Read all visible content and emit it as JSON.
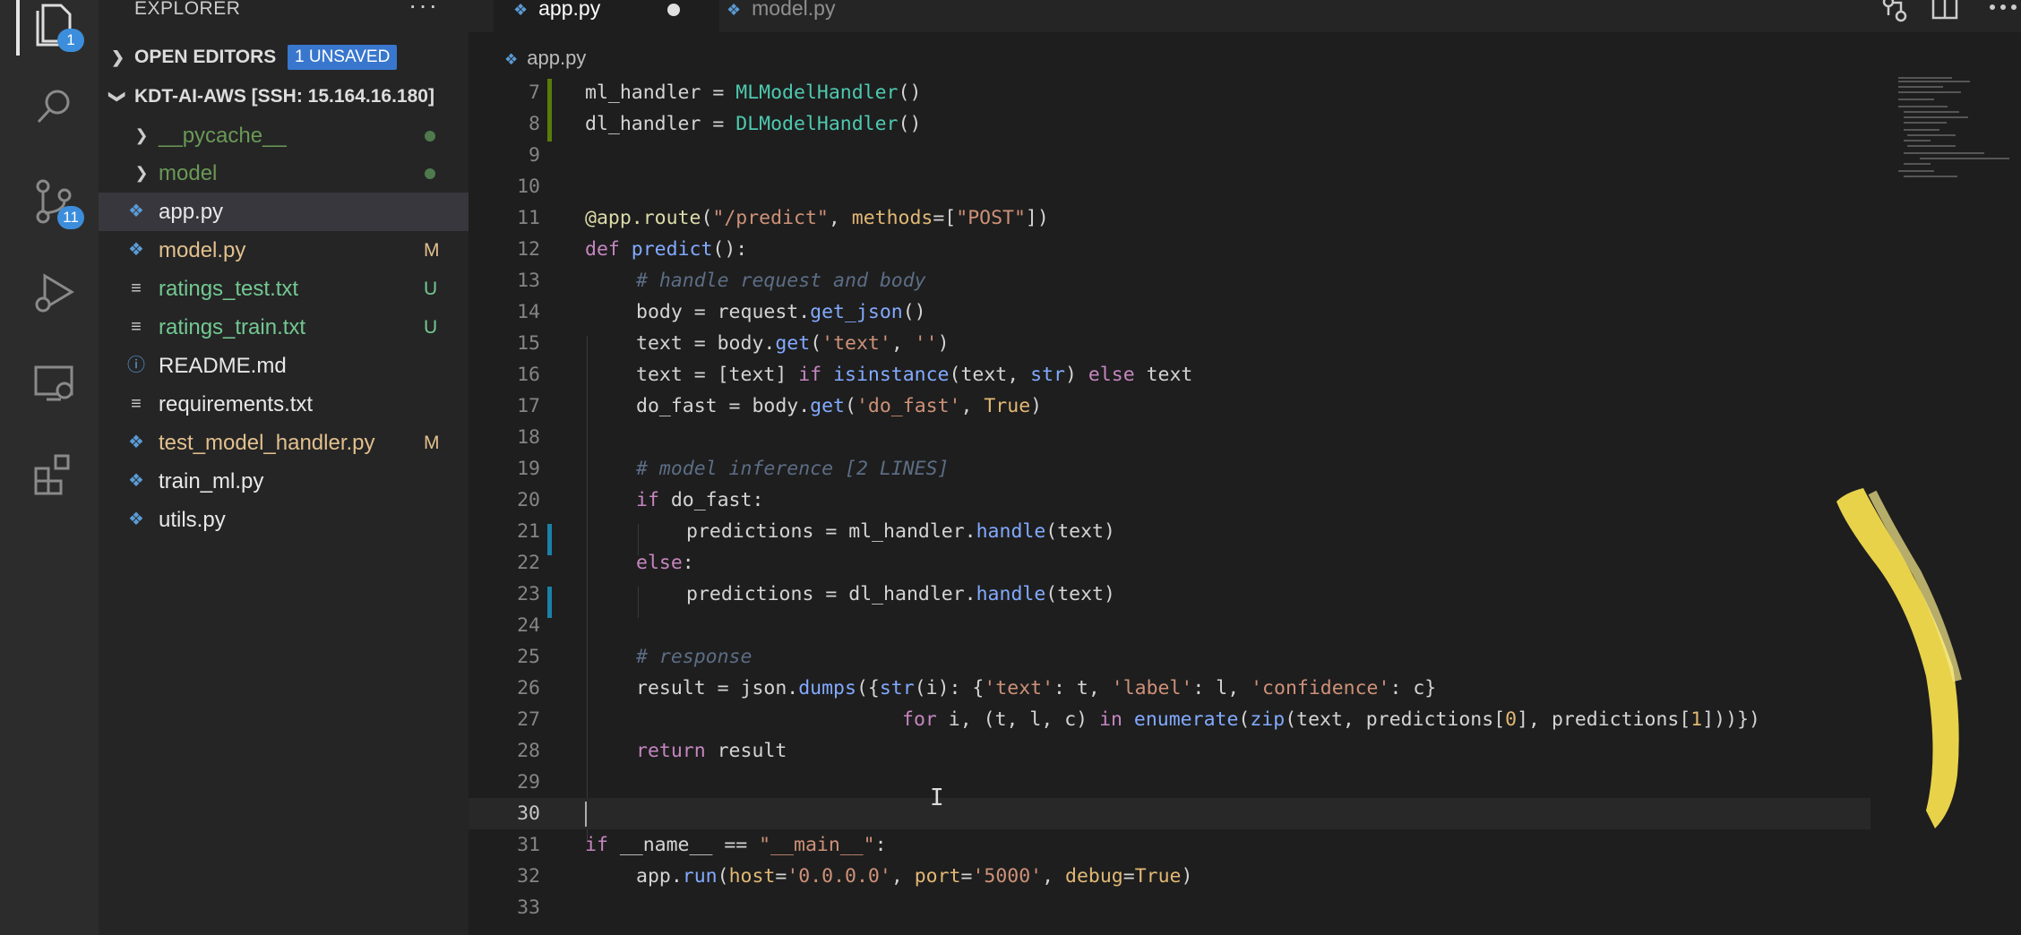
{
  "activity_bar": {
    "explorer_badge": "1",
    "source_control_badge": "11"
  },
  "sidebar": {
    "title": "EXPLORER",
    "more_label": "···",
    "open_editors": {
      "label": "OPEN EDITORS",
      "badge": "1 UNSAVED"
    },
    "workspace": {
      "label": "KDT-AI-AWS [SSH: 15.164.16.180]"
    },
    "files": [
      {
        "name": "__pycache__",
        "status": ""
      },
      {
        "name": "model",
        "status": ""
      },
      {
        "name": "app.py",
        "status": ""
      },
      {
        "name": "model.py",
        "status": "M"
      },
      {
        "name": "ratings_test.txt",
        "status": "U"
      },
      {
        "name": "ratings_train.txt",
        "status": "U"
      },
      {
        "name": "README.md",
        "status": ""
      },
      {
        "name": "requirements.txt",
        "status": ""
      },
      {
        "name": "test_model_handler.py",
        "status": "M"
      },
      {
        "name": "train_ml.py",
        "status": ""
      },
      {
        "name": "utils.py",
        "status": ""
      }
    ]
  },
  "tabs": [
    {
      "label": "app.py"
    },
    {
      "label": "model.py"
    }
  ],
  "breadcrumb": {
    "file": "app.py"
  },
  "editor": {
    "line_numbers": [
      "7",
      "8",
      "9",
      "10",
      "11",
      "12",
      "13",
      "14",
      "15",
      "16",
      "17",
      "18",
      "19",
      "20",
      "21",
      "22",
      "23",
      "24",
      "25",
      "26",
      "27",
      "28",
      "29",
      "30",
      "31",
      "32",
      "33"
    ],
    "lines": {
      "l7": {
        "a": "ml_handler = ",
        "b": "MLModelHandler",
        "c": "()"
      },
      "l8": {
        "a": "dl_handler = ",
        "b": "DLModelHandler",
        "c": "()"
      },
      "l11": {
        "a": "@app.route",
        "b": "(",
        "c": "\"/predict\"",
        "d": ", ",
        "e": "methods",
        "f": "=[",
        "g": "\"POST\"",
        "h": "])"
      },
      "l12": {
        "a": "def",
        "b": " ",
        "c": "predict",
        "d": "():"
      },
      "l13": {
        "a": "# handle request and body"
      },
      "l14": {
        "a": "body = request.",
        "b": "get_json",
        "c": "()"
      },
      "l15": {
        "a": "text = body.",
        "b": "get",
        "c": "(",
        "d": "'text'",
        "e": ", ",
        "f": "''",
        "g": ")"
      },
      "l16": {
        "a": "text = [text] ",
        "b": "if",
        "c": " ",
        "d": "isinstance",
        "e": "(text, ",
        "f": "str",
        "g": ") ",
        "h": "else",
        "i": " text"
      },
      "l17": {
        "a": "do_fast = body.",
        "b": "get",
        "c": "(",
        "d": "'do_fast'",
        "e": ", ",
        "f": "True",
        "g": ")"
      },
      "l19": {
        "a": "# model inference [2 LINES]"
      },
      "l20": {
        "a": "if",
        "b": " do_fast:"
      },
      "l21": {
        "a": "predictions = ml_handler.",
        "b": "handle",
        "c": "(text)"
      },
      "l22": {
        "a": "else",
        "b": ":"
      },
      "l23": {
        "a": "predictions = dl_handler.",
        "b": "handle",
        "c": "(text)"
      },
      "l25": {
        "a": "# response"
      },
      "l26": {
        "a": "result = json.",
        "b": "dumps",
        "c": "({",
        "d": "str",
        "e": "(i): {",
        "f": "'text'",
        "g": ": t, ",
        "h": "'label'",
        "i": ": l, ",
        "j": "'confidence'",
        "k": ": c}"
      },
      "l27": {
        "a": "for",
        "b": " i, (t, l, c) ",
        "c": "in",
        "d": " ",
        "e": "enumerate",
        "f": "(",
        "g": "zip",
        "h": "(text, predictions[",
        "i": "0",
        "j": "], predictions[",
        "k": "1",
        "l": "]))})"
      },
      "l28": {
        "a": "return",
        "b": " result"
      },
      "l31": {
        "a": "if",
        "b": " __name__ == ",
        "c": "\"__main__\"",
        "d": ":"
      },
      "l32": {
        "a": "app.",
        "b": "run",
        "c": "(",
        "d": "host",
        "e": "=",
        "f": "'0.0.0.0'",
        "g": ", ",
        "h": "port",
        "i": "=",
        "j": "'5000'",
        "k": ", ",
        "l": "debug",
        "m": "=",
        "n": "True",
        "o": ")"
      }
    }
  },
  "colors": {
    "accent": "#3c8edc",
    "modified": "#e2c08d",
    "untracked": "#73c991"
  }
}
